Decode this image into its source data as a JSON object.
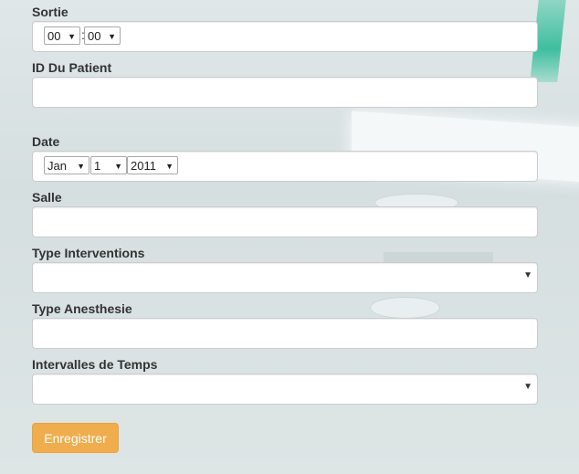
{
  "form": {
    "sortie": {
      "label": "Sortie",
      "hour": "00",
      "minute": "00",
      "separator": ":"
    },
    "patient_id": {
      "label": "ID Du Patient",
      "value": ""
    },
    "date": {
      "label": "Date",
      "month": "Jan",
      "day": "1",
      "year": "2011"
    },
    "salle": {
      "label": "Salle",
      "value": ""
    },
    "type_interventions": {
      "label": "Type Interventions",
      "selected": ""
    },
    "type_anesthesie": {
      "label": "Type Anesthesie",
      "value": ""
    },
    "intervalles_temps": {
      "label": "Intervalles de Temps",
      "selected": ""
    },
    "submit_label": "Enregistrer"
  },
  "icons": {
    "select_arrow": "chevron-down-icon",
    "dropdown_arrow": "caret-down-icon"
  },
  "colors": {
    "button_bg": "#f0ad4e",
    "button_text": "#ffffff",
    "label_text": "#333333"
  }
}
